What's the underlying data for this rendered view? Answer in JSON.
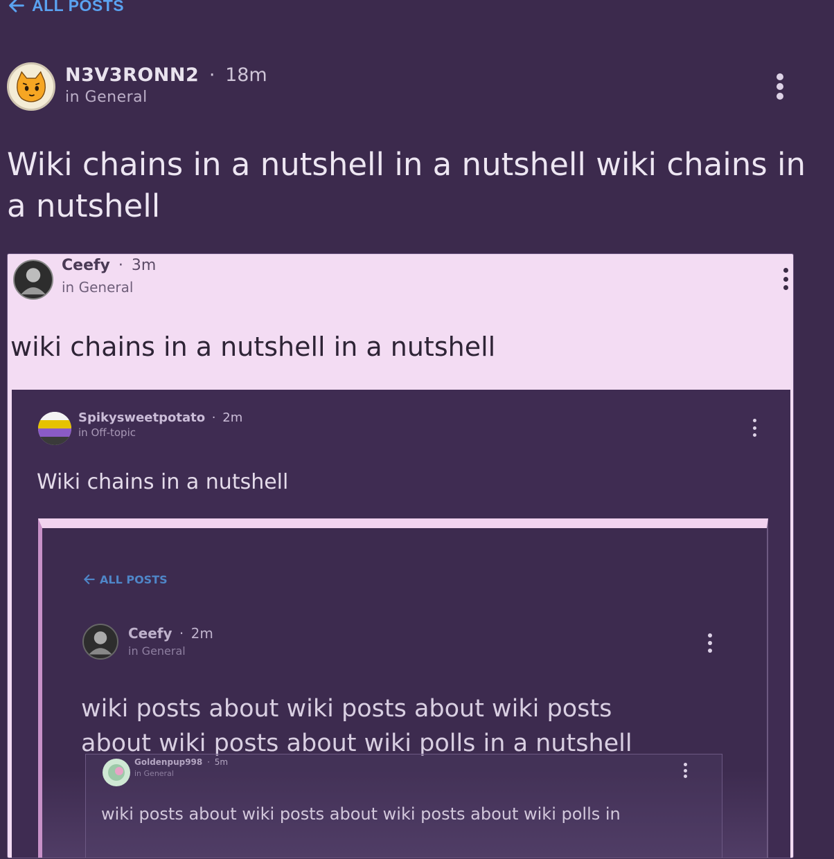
{
  "nav": {
    "back_label": "ALL POSTS"
  },
  "post": {
    "author": "N3V3RONN2",
    "separator": "·",
    "time": "18m",
    "category": "in General",
    "title": "Wiki chains in a nutshell in a nutshell wiki chains in a nutshell"
  },
  "embed1": {
    "author": "Ceefy",
    "separator": "·",
    "time": "3m",
    "category": "in General",
    "title": "wiki chains in a nutshell in a nutshell"
  },
  "embed2": {
    "author": "Spikysweetpotato",
    "separator": "·",
    "time": "2m",
    "category": "in Off-topic",
    "title": "Wiki chains in a nutshell"
  },
  "embed3": {
    "back_label": "ALL POSTS",
    "author": "Ceefy",
    "separator": "·",
    "time": "2m",
    "category": "in General",
    "title_line1": "wiki posts about wiki posts about wiki posts",
    "title_line2": "about wiki posts about wiki polls in a nutshell"
  },
  "embed4": {
    "author": "Goldenpup998",
    "separator": "·",
    "time": "5m",
    "category": "in General",
    "title": "wiki posts about wiki posts about wiki posts about wiki polls in"
  },
  "colors": {
    "background": "#3c2a4d",
    "link": "#5aa2f0",
    "embed_light": "#f3dcf3"
  }
}
